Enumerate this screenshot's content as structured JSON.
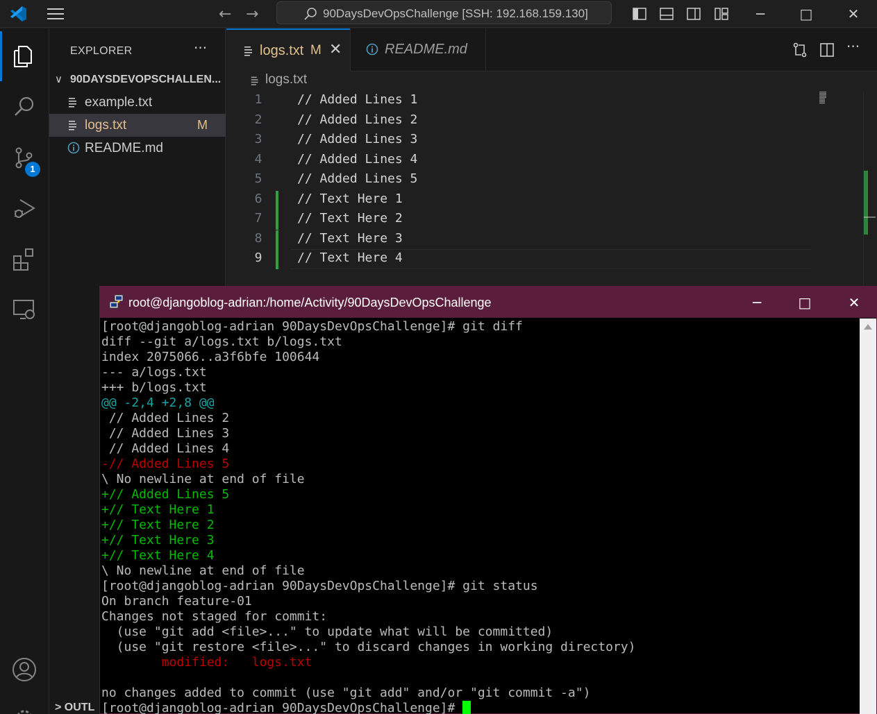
{
  "titlebar": {
    "command_center": "90DaysDevOpsChallenge [SSH: 192.168.159.130]",
    "back_glyph": "←",
    "forward_glyph": "→",
    "minimize_glyph": "─",
    "maximize_glyph": "□",
    "close_glyph": "✕"
  },
  "activity_bar": {
    "items": [
      {
        "icon": "files-icon",
        "active": true
      },
      {
        "icon": "search-icon"
      },
      {
        "icon": "source-control-icon",
        "badge": "1"
      },
      {
        "icon": "run-debug-icon"
      },
      {
        "icon": "extensions-icon"
      },
      {
        "icon": "remote-explorer-icon"
      },
      {
        "icon": "account-icon"
      },
      {
        "icon": "settings-gear-icon"
      }
    ]
  },
  "explorer": {
    "header": "EXPLORER",
    "more_glyph": "···",
    "folder": {
      "name": "90DAYSDEVOPSCHALLEN...",
      "chevron": "∨"
    },
    "files": [
      {
        "name": "example.txt",
        "icon": "text-file-icon",
        "status": ""
      },
      {
        "name": "logs.txt",
        "icon": "text-file-icon",
        "status": "M",
        "selected": true
      },
      {
        "name": "README.md",
        "icon": "info-icon",
        "status": ""
      }
    ],
    "outline_label": "OUTL",
    "outline_chevron": ">"
  },
  "editor": {
    "tabs": [
      {
        "label": "logs.txt",
        "modified": "M",
        "close": "✕",
        "active": true
      },
      {
        "label": "README.md",
        "preview": true
      }
    ],
    "breadcrumb": "logs.txt",
    "lines": [
      {
        "n": "1",
        "text": "// Added Lines 1",
        "changed": false
      },
      {
        "n": "2",
        "text": "// Added Lines 2",
        "changed": false
      },
      {
        "n": "3",
        "text": "// Added Lines 3",
        "changed": false
      },
      {
        "n": "4",
        "text": "// Added Lines 4",
        "changed": false
      },
      {
        "n": "5",
        "text": "// Added Lines 5",
        "changed": false
      },
      {
        "n": "6",
        "text": "// Text Here 1",
        "changed": true
      },
      {
        "n": "7",
        "text": "// Text Here 2",
        "changed": true
      },
      {
        "n": "8",
        "text": "// Text Here 3",
        "changed": true
      },
      {
        "n": "9",
        "text": "// Text Here 4",
        "changed": true,
        "current": true
      }
    ],
    "more_glyph": "···"
  },
  "terminal": {
    "window_title": "root@djangoblog-adrian:/home/Activity/90DaysDevOpsChallenge",
    "minimize_glyph": "─",
    "maximize_glyph": "□",
    "close_glyph": "✕",
    "lines": [
      {
        "text": "[root@djangoblog-adrian 90DaysDevOpsChallenge]# git diff",
        "color": "white"
      },
      {
        "text": "diff --git a/logs.txt b/logs.txt",
        "color": "white"
      },
      {
        "text": "index 2075066..a3f6bfe 100644",
        "color": "white"
      },
      {
        "text": "--- a/logs.txt",
        "color": "white"
      },
      {
        "text": "+++ b/logs.txt",
        "color": "white"
      },
      {
        "text": "@@ -2,4 +2,8 @@",
        "color": "cyan"
      },
      {
        "text": " // Added Lines 2",
        "color": "white"
      },
      {
        "text": " // Added Lines 3",
        "color": "white"
      },
      {
        "text": " // Added Lines 4",
        "color": "white"
      },
      {
        "text": "-// Added Lines 5",
        "color": "red"
      },
      {
        "text": "\\ No newline at end of file",
        "color": "white"
      },
      {
        "text": "+// Added Lines 5",
        "color": "green"
      },
      {
        "text": "+// Text Here 1",
        "color": "green"
      },
      {
        "text": "+// Text Here 2",
        "color": "green"
      },
      {
        "text": "+// Text Here 3",
        "color": "green"
      },
      {
        "text": "+// Text Here 4",
        "color": "green"
      },
      {
        "text": "\\ No newline at end of file",
        "color": "white"
      },
      {
        "text": "[root@djangoblog-adrian 90DaysDevOpsChallenge]# git status",
        "color": "white"
      },
      {
        "text": "On branch feature-01",
        "color": "white"
      },
      {
        "text": "Changes not staged for commit:",
        "color": "white"
      },
      {
        "text": "  (use \"git add <file>...\" to update what will be committed)",
        "color": "white"
      },
      {
        "text": "  (use \"git restore <file>...\" to discard changes in working directory)",
        "color": "white"
      },
      {
        "text": "        modified:   logs.txt",
        "color": "red"
      },
      {
        "text": "",
        "color": "white"
      },
      {
        "text": "no changes added to commit (use \"git add\" and/or \"git commit -a\")",
        "color": "white"
      },
      {
        "text": "[root@djangoblog-adrian 90DaysDevOpsChallenge]# ",
        "color": "white",
        "cursor": true
      }
    ]
  },
  "colors": {
    "accent": "#0078d4",
    "modified": "#e2c08d",
    "added_gutter": "#2ea043",
    "putty_title": "#5a1e3c",
    "term_green": "#00bb00",
    "term_red": "#bb0000",
    "term_cyan": "#1aa3a3"
  }
}
